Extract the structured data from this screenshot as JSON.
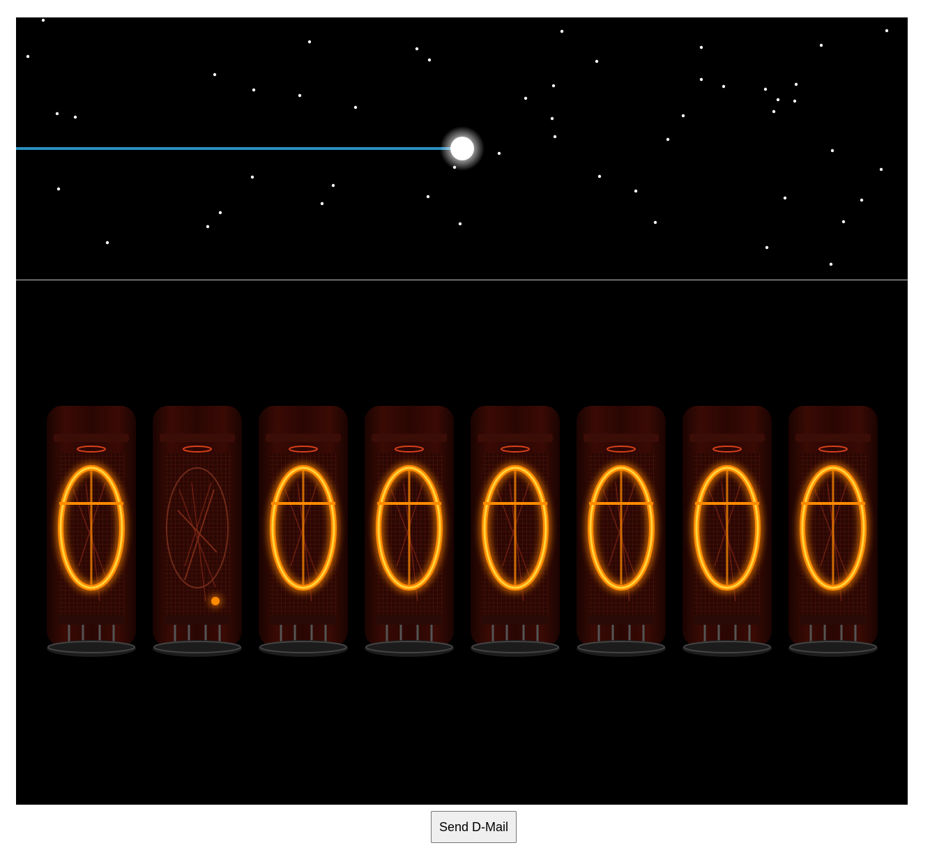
{
  "divergence_meter": {
    "digits": [
      {
        "value": "0",
        "decimal_point": false
      },
      {
        "value": "",
        "decimal_point": true
      },
      {
        "value": "0",
        "decimal_point": false
      },
      {
        "value": "0",
        "decimal_point": false
      },
      {
        "value": "0",
        "decimal_point": false
      },
      {
        "value": "0",
        "decimal_point": false
      },
      {
        "value": "0",
        "decimal_point": false
      },
      {
        "value": "0",
        "decimal_point": false
      }
    ],
    "glow_color": "#ff8a00",
    "core_color": "#ffd23a"
  },
  "worldline": {
    "line_color": "#2b8fc0",
    "node_color": "#ffffff"
  },
  "controls": {
    "send_label": "Send D-Mail"
  }
}
